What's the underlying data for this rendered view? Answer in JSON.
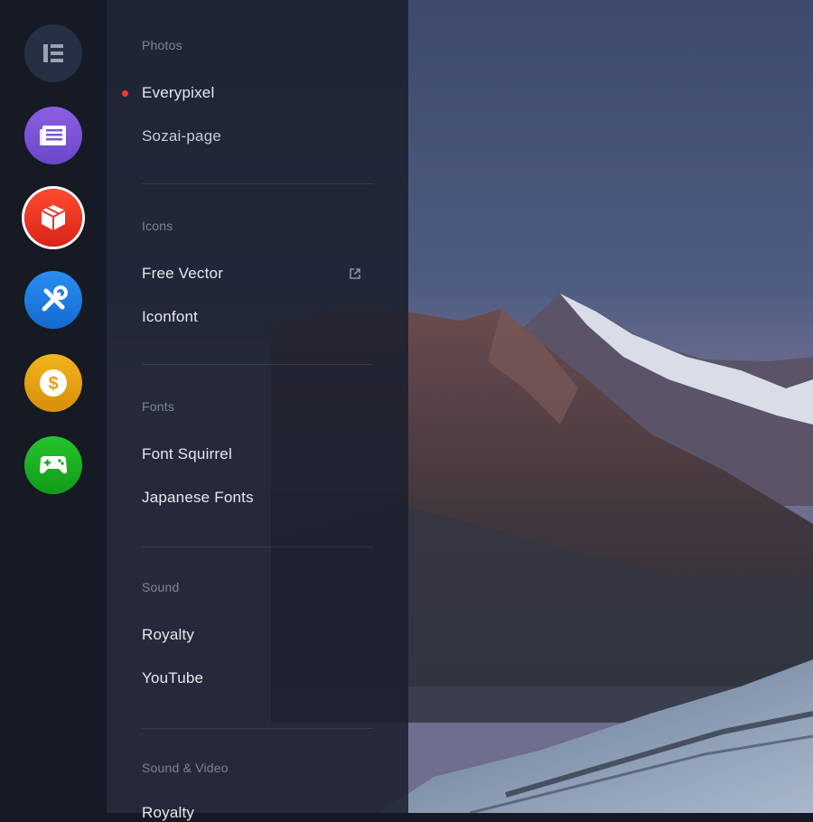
{
  "rail": {
    "items": [
      {
        "icon": "elementor-logo-icon",
        "color": "#243044"
      },
      {
        "icon": "news-icon",
        "color": "#7b56d6"
      },
      {
        "icon": "box-icon",
        "color": "#ee2f1f",
        "active": true
      },
      {
        "icon": "tools-icon",
        "color": "#1a7be0"
      },
      {
        "icon": "dollar-coin-icon",
        "color": "#e4a012"
      },
      {
        "icon": "gamepad-icon",
        "color": "#19a81f"
      }
    ]
  },
  "menu": {
    "photos": {
      "label": "Photos",
      "items": [
        "Everypixel",
        "Sozai-page"
      ],
      "selected": "Everypixel"
    },
    "icons": {
      "label": "Icons",
      "items": [
        "Free Vector",
        "Iconfont"
      ],
      "external_icon": "external-link-icon"
    },
    "fonts": {
      "label": "Fonts",
      "items": [
        "Font Squirrel",
        "Japanese Fonts"
      ]
    },
    "sound": {
      "label": "Sound",
      "items": [
        "Royalty",
        "YouTube"
      ]
    },
    "sound_video": {
      "label": "Sound & Video",
      "items": [
        "Royalty"
      ]
    }
  },
  "colors": {
    "selected_dot": "#ef3b2c",
    "panel_bg": "#1b202d",
    "rail_bg": "#161a25"
  }
}
